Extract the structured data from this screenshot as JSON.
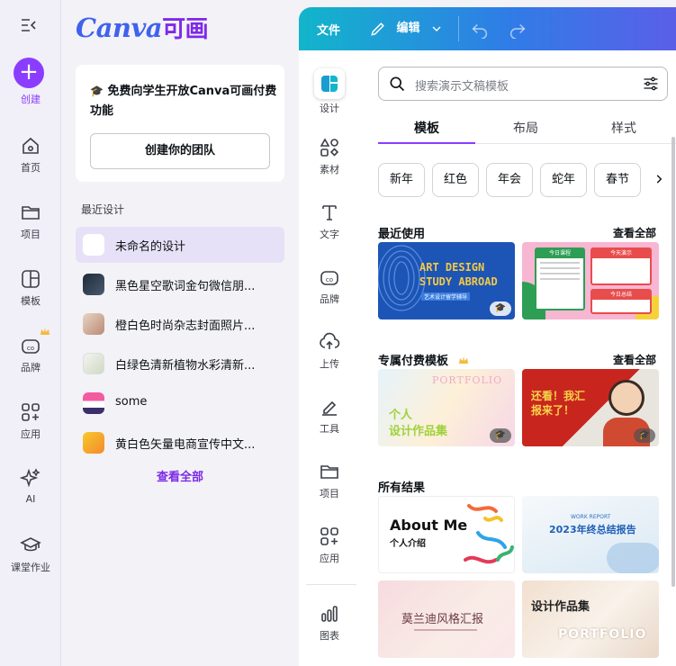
{
  "rail": {
    "create_label": "创建",
    "items": [
      {
        "label": "首页",
        "icon": "home-icon"
      },
      {
        "label": "项目",
        "icon": "folder-icon"
      },
      {
        "label": "模板",
        "icon": "template-icon"
      },
      {
        "label": "品牌",
        "icon": "brand-icon"
      },
      {
        "label": "应用",
        "icon": "apps-icon"
      },
      {
        "label": "AI",
        "icon": "sparkle-icon"
      },
      {
        "label": "课堂作业",
        "icon": "graduation-cap-icon"
      }
    ]
  },
  "panel": {
    "logo_text": "Canva",
    "logo_cn": "可画",
    "promo_text": "免费向学生开放Canva可画付费功能",
    "promo_button": "创建你的团队",
    "recent_title": "最近设计",
    "recent_items": [
      {
        "name": "未命名的设计",
        "active": true
      },
      {
        "name": "黑色星空歌词金句微信朋..."
      },
      {
        "name": "橙白色时尚杂志封面照片..."
      },
      {
        "name": "白绿色清新植物水彩清新..."
      },
      {
        "name": "some"
      },
      {
        "name": "黄白色矢量电商宣传中文..."
      }
    ],
    "see_all": "查看全部"
  },
  "topbar": {
    "file_label": "文件",
    "edit_label": "编辑"
  },
  "side": {
    "items": [
      {
        "label": "设计",
        "icon": "design-icon"
      },
      {
        "label": "素材",
        "icon": "elements-icon"
      },
      {
        "label": "文字",
        "icon": "text-icon"
      },
      {
        "label": "品牌",
        "icon": "brand-icon"
      },
      {
        "label": "上传",
        "icon": "upload-icon"
      },
      {
        "label": "工具",
        "icon": "draw-icon"
      },
      {
        "label": "项目",
        "icon": "folder-icon"
      },
      {
        "label": "应用",
        "icon": "apps-icon"
      },
      {
        "label": "图表",
        "icon": "chart-icon"
      }
    ]
  },
  "content": {
    "search_placeholder": "搜索演示文稿模板",
    "tabs": [
      "模板",
      "布局",
      "样式"
    ],
    "chips": [
      "新年",
      "红色",
      "年会",
      "蛇年",
      "春节"
    ],
    "recent_used_title": "最近使用",
    "premium_title": "专属付费模板",
    "all_results_title": "所有结果",
    "see_all": "查看全部",
    "cards": {
      "art_design_title": "ART DESIGN",
      "art_design_subtitle": "STUDY ABROAD",
      "art_design_caption": "艺术设计留学辅导",
      "schedule_left": "今日课程",
      "schedule_right": "今天演示",
      "schedule_bottom": "今日总结",
      "portfolio_en": "PORTFOLIO",
      "portfolio_cn_1": "个人",
      "portfolio_cn_2": "设计作品集",
      "report_cn": "还看！我汇报来了！",
      "about_me": "About Me",
      "about_me_cn": "个人介绍",
      "work_report": "WORK REPORT",
      "year_report": "2023年终总结报告",
      "morandi": "莫兰迪风格汇报",
      "works_cn": "设计作品集",
      "works_en": "PORTFOLIO"
    }
  },
  "colors": {
    "accent": "#8b3dff",
    "logo_blue": "#3f63ed",
    "logo_purple": "#7d2ae8"
  }
}
